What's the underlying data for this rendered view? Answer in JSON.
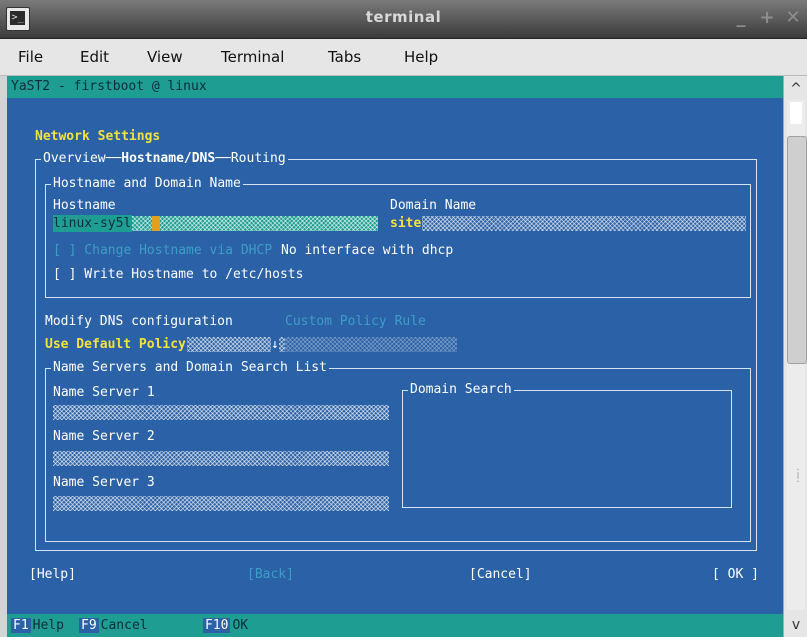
{
  "window": {
    "title": "terminal",
    "min_glyph": "_",
    "max_glyph": "+",
    "close_glyph": "✕",
    "app_icon": "terminal-icon"
  },
  "menu": [
    {
      "label": "File"
    },
    {
      "label": "Edit"
    },
    {
      "label": "View"
    },
    {
      "label": "Terminal"
    },
    {
      "label": "Tabs"
    },
    {
      "label": "Help"
    }
  ],
  "caption": "YaST2 - firstboot @ linux",
  "screen": {
    "heading": "Network Settings",
    "tabs": {
      "overview": "Overview",
      "hostname_dns": "Hostname/DNS",
      "routing": "Routing"
    },
    "hostname_frame": {
      "title": "Hostname and Domain Name",
      "hostname_label": "Hostname",
      "hostname_value": "linux-sy5l",
      "domain_label": "Domain Name",
      "domain_value": "site",
      "dhcp_checkbox": "[ ] Change Hostname via DHCP",
      "dhcp_note": "No interface with dhcp",
      "hosts_checkbox": "[ ] Write Hostname to /etc/hosts"
    },
    "dns": {
      "modify_label": "Modify DNS configuration",
      "custom_policy_label": "Custom Policy Rule",
      "policy_value": "Use Default Policy"
    },
    "ns_frame": {
      "title": "Name Servers and Domain Search List",
      "ns1": "Name Server 1",
      "ns2": "Name Server 2",
      "ns3": "Name Server 3",
      "domain_search": "Domain Search"
    },
    "buttons": {
      "help": "[Help]",
      "back": "[Back]",
      "cancel": "[Cancel]",
      "ok": "[ OK ]"
    },
    "fkeys": [
      {
        "key": "F1",
        "label": "Help"
      },
      {
        "key": "F9",
        "label": "Cancel"
      },
      {
        "key": "F10",
        "label": "OK"
      }
    ]
  },
  "colors": {
    "terminal_bg": "#2b61a6",
    "caption_bg": "#1e9d93",
    "hotkey": "#f4e23c",
    "inactive": "#3c9ec6"
  }
}
